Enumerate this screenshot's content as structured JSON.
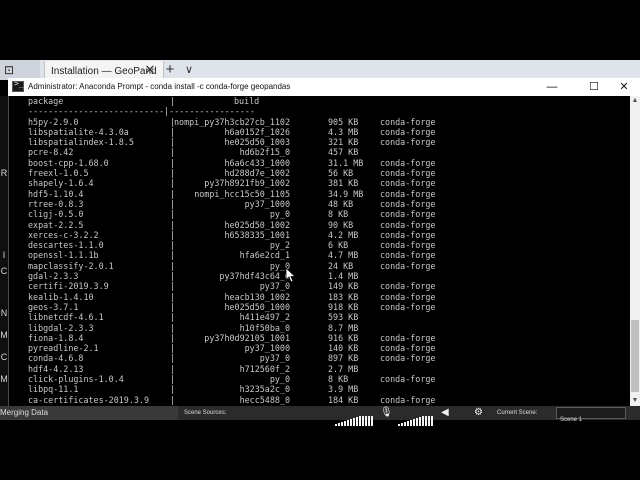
{
  "browser": {
    "left_tab_label": "⊡",
    "active_tab_title": "Installation — GeoPand",
    "tab_close_glyph": "✕",
    "new_tab_glyph": "+",
    "tab_list_glyph": "∨"
  },
  "console": {
    "title": "Administrator: Anaconda Prompt - conda  install -c conda-forge geopandas",
    "icon_glyph": ">_",
    "controls": {
      "minimize": "—",
      "maximize": "☐",
      "close": "✕"
    },
    "header": {
      "package": "package",
      "build": "build",
      "divider": "---------------------------|-----------------"
    },
    "packages": [
      {
        "name": "h5py-2.9.0",
        "build": "nompi_py37h3cb27cb_1102",
        "size": "905 KB",
        "channel": "conda-forge"
      },
      {
        "name": "libspatialite-4.3.0a",
        "build": "h6a0152f_1026",
        "size": "4.3 MB",
        "channel": "conda-forge"
      },
      {
        "name": "libspatialindex-1.8.5",
        "build": "he025d50_1003",
        "size": "321 KB",
        "channel": "conda-forge"
      },
      {
        "name": "pcre-8.42",
        "build": "hd6b2f15_0",
        "size": "457 KB",
        "channel": ""
      },
      {
        "name": "boost-cpp-1.68.0",
        "build": "h6a6c433_1000",
        "size": "31.1 MB",
        "channel": "conda-forge"
      },
      {
        "name": "freexl-1.0.5",
        "build": "hd288d7e_1002",
        "size": "56 KB",
        "channel": "conda-forge"
      },
      {
        "name": "shapely-1.6.4",
        "build": "py37h8921fb9_1002",
        "size": "381 KB",
        "channel": "conda-forge"
      },
      {
        "name": "hdf5-1.10.4",
        "build": "nompi_hcc15c50_1105",
        "size": "34.9 MB",
        "channel": "conda-forge"
      },
      {
        "name": "rtree-0.8.3",
        "build": "py37_1000",
        "size": "48 KB",
        "channel": "conda-forge"
      },
      {
        "name": "cligj-0.5.0",
        "build": "py_0",
        "size": "8 KB",
        "channel": "conda-forge"
      },
      {
        "name": "expat-2.2.5",
        "build": "he025d50_1002",
        "size": "90 KB",
        "channel": "conda-forge"
      },
      {
        "name": "xerces-c-3.2.2",
        "build": "h6538335_1001",
        "size": "4.2 MB",
        "channel": "conda-forge"
      },
      {
        "name": "descartes-1.1.0",
        "build": "py_2",
        "size": "6 KB",
        "channel": "conda-forge"
      },
      {
        "name": "openssl-1.1.1b",
        "build": "hfa6e2cd_1",
        "size": "4.7 MB",
        "channel": "conda-forge"
      },
      {
        "name": "mapclassify-2.0.1",
        "build": "py_0",
        "size": "24 KB",
        "channel": "conda-forge"
      },
      {
        "name": "gdal-2.3.3",
        "build": "py37hdf43c64_0",
        "size": "1.4 MB",
        "channel": ""
      },
      {
        "name": "certifi-2019.3.9",
        "build": "py37_0",
        "size": "149 KB",
        "channel": "conda-forge"
      },
      {
        "name": "kealib-1.4.10",
        "build": "heacb130_1002",
        "size": "183 KB",
        "channel": "conda-forge"
      },
      {
        "name": "geos-3.7.1",
        "build": "he025d50_1000",
        "size": "918 KB",
        "channel": "conda-forge"
      },
      {
        "name": "libnetcdf-4.6.1",
        "build": "h411e497_2",
        "size": "593 KB",
        "channel": ""
      },
      {
        "name": "libgdal-2.3.3",
        "build": "h10f50ba_0",
        "size": "8.7 MB",
        "channel": ""
      },
      {
        "name": "fiona-1.8.4",
        "build": "py37h0d92105_1001",
        "size": "916 KB",
        "channel": "conda-forge"
      },
      {
        "name": "pyreadline-2.1",
        "build": "py37_1000",
        "size": "140 KB",
        "channel": "conda-forge"
      },
      {
        "name": "conda-4.6.8",
        "build": "py37_0",
        "size": "897 KB",
        "channel": "conda-forge"
      },
      {
        "name": "hdf4-4.2.13",
        "build": "h712560f_2",
        "size": "2.7 MB",
        "channel": ""
      },
      {
        "name": "click-plugins-1.0.4",
        "build": "py_0",
        "size": "8 KB",
        "channel": "conda-forge"
      },
      {
        "name": "libpq-11.1",
        "build": "h3235a2c_0",
        "size": "3.9 MB",
        "channel": ""
      },
      {
        "name": "ca-certificates-2019.3.9",
        "build": "hecc5488_0",
        "size": "184 KB",
        "channel": "conda-forge"
      }
    ]
  },
  "left_strip_letters": [
    "R",
    "I",
    "C",
    "N",
    "M",
    "C",
    "M"
  ],
  "obs": {
    "merging_label": "Merging Data",
    "scene_sources_label": "Scene Sources:",
    "current_scene_label": "Current Scene:",
    "current_scene_value": "Scene 1",
    "mic_icon": "🎙",
    "speaker_icon": "◀",
    "gear_icon": "⚙"
  }
}
